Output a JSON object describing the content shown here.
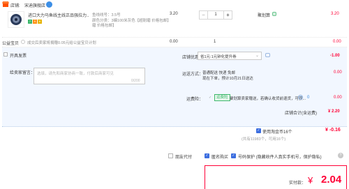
{
  "store": {
    "label": "店铺:",
    "name": "宋迪旗舰店"
  },
  "item": {
    "title": "进口大力马鱼线主线正品强拉力...",
    "spec_line": "鱼线线号：3.5号",
    "spec_color": "颜色分类：3编100米灰色【超耐磨 价格包邮】",
    "spec_extra": "磨 价格包邮】",
    "unit_price": "3.20",
    "quantity": "1",
    "shipping": "聚划算",
    "total": "3.20",
    "badges": [
      "7",
      "天",
      "¥"
    ]
  },
  "charity": {
    "label": "公益宝贝",
    "text": "成交后卖家将捐赠0.05元给公益宝贝计划",
    "price": "0.00",
    "qty": "1",
    "total": "0.00"
  },
  "invoice": {
    "label": "开具发票"
  },
  "message": {
    "label": "给卖家留言：",
    "placeholder": "选填，请先和商家协商一致，付款后商家可见",
    "count": "0/200"
  },
  "promo": {
    "label": "店铺优惠：",
    "selected": "省1元:1元钟化提升券",
    "amount": "-1.00"
  },
  "delivery": {
    "label": "运送方式：",
    "method": "普通配送 快递 免邮",
    "eta_1": "现在下单，预计10月21日送达",
    "eta_2": "",
    "fee": "0.00"
  },
  "insurance": {
    "label": "运费险：",
    "tag": "运费险",
    "text": "聚划算卖家赠送，若确认收货前退货，可获...",
    "help": "?",
    "price": "0",
    "total": "0.00"
  },
  "store_total": {
    "label": "店铺合计(含运费)",
    "value": "¥ 2.20"
  },
  "coins": {
    "label": "使用淘金币16个",
    "value": "¥ -0.16",
    "note": "(共有11983个，可用16个)"
  },
  "options": {
    "friend_pay": "朋友代付",
    "anonymous": "匿名购买",
    "privacy": "号码保护 (隐藏收件人真实手机号，保护隐私)",
    "help": "?"
  },
  "payment": {
    "label": "实付款：",
    "currency": "¥",
    "amount": "2.04"
  },
  "colors": {
    "accent_red": "#ff0036",
    "accent_blue": "#3c6ee0",
    "panel_bg": "#f2f7ff"
  }
}
